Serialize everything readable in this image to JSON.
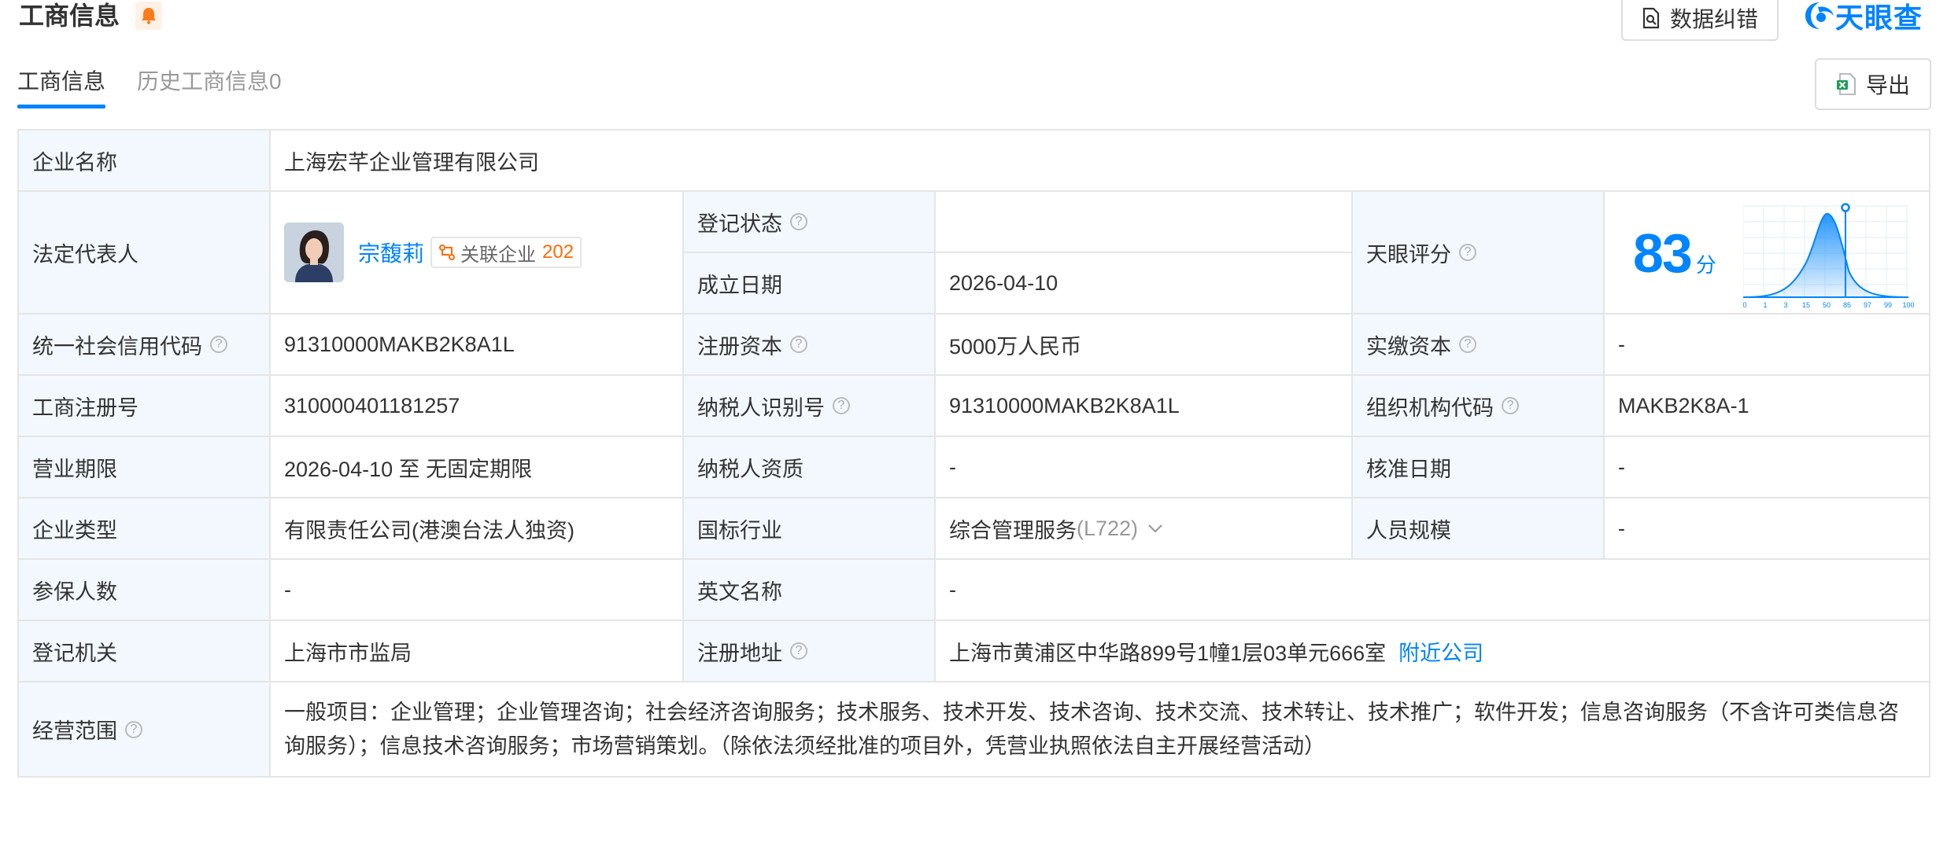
{
  "header": {
    "title": "工商信息",
    "feedback_label": "数据纠错",
    "logo_text": "天眼查",
    "export_label": "导出"
  },
  "tabs": [
    {
      "label": "工商信息",
      "active": true
    },
    {
      "label": "历史工商信息0",
      "active": false
    }
  ],
  "info": {
    "company_name_label": "企业名称",
    "company_name": "上海宏芊企业管理有限公司",
    "legal_rep_label": "法定代表人",
    "legal_rep_name": "宗馥莉",
    "related_label": "关联企业",
    "related_count": "202",
    "reg_status_label": "登记状态",
    "reg_status": "",
    "founded_label": "成立日期",
    "founded": "2026-04-10",
    "score_label": "天眼评分",
    "score": "83",
    "score_unit": "分",
    "score_axis": [
      "0",
      "1",
      "3",
      "15",
      "50",
      "85",
      "97",
      "99",
      "100"
    ],
    "uscc_label": "统一社会信用代码",
    "uscc": "91310000MAKB2K8A1L",
    "reg_capital_label": "注册资本",
    "reg_capital": "5000万人民币",
    "paid_capital_label": "实缴资本",
    "paid_capital": "-",
    "reg_no_label": "工商注册号",
    "reg_no": "310000401181257",
    "taxpayer_id_label": "纳税人识别号",
    "taxpayer_id": "91310000MAKB2K8A1L",
    "org_code_label": "组织机构代码",
    "org_code": "MAKB2K8A-1",
    "term_label": "营业期限",
    "term": "2026-04-10 至 无固定期限",
    "taxpayer_qual_label": "纳税人资质",
    "taxpayer_qual": "-",
    "approval_date_label": "核准日期",
    "approval_date": "-",
    "company_type_label": "企业类型",
    "company_type": "有限责任公司(港澳台法人独资)",
    "industry_label": "国标行业",
    "industry": "综合管理服务",
    "industry_code": "(L722)",
    "staff_size_label": "人员规模",
    "staff_size": "-",
    "insured_label": "参保人数",
    "insured": "-",
    "english_name_label": "英文名称",
    "english_name": "-",
    "authority_label": "登记机关",
    "authority": "上海市市监局",
    "address_label": "注册地址",
    "address": "上海市黄浦区中华路899号1幢1层03单元666室",
    "nearby_label": "附近公司",
    "scope_label": "经营范围",
    "scope": "一般项目：企业管理；企业管理咨询；社会经济咨询服务；技术服务、技术开发、技术咨询、技术交流、技术转让、技术推广；软件开发；信息咨询服务（不含许可类信息咨询服务）；信息技术咨询服务；市场营销策划。（除依法须经批准的项目外，凭营业执照依法自主开展经营活动）"
  },
  "colors": {
    "accent": "#0084ff",
    "label_bg": "#f2f8fe",
    "border": "#e5e5e5",
    "warning": "#ff6a00"
  }
}
